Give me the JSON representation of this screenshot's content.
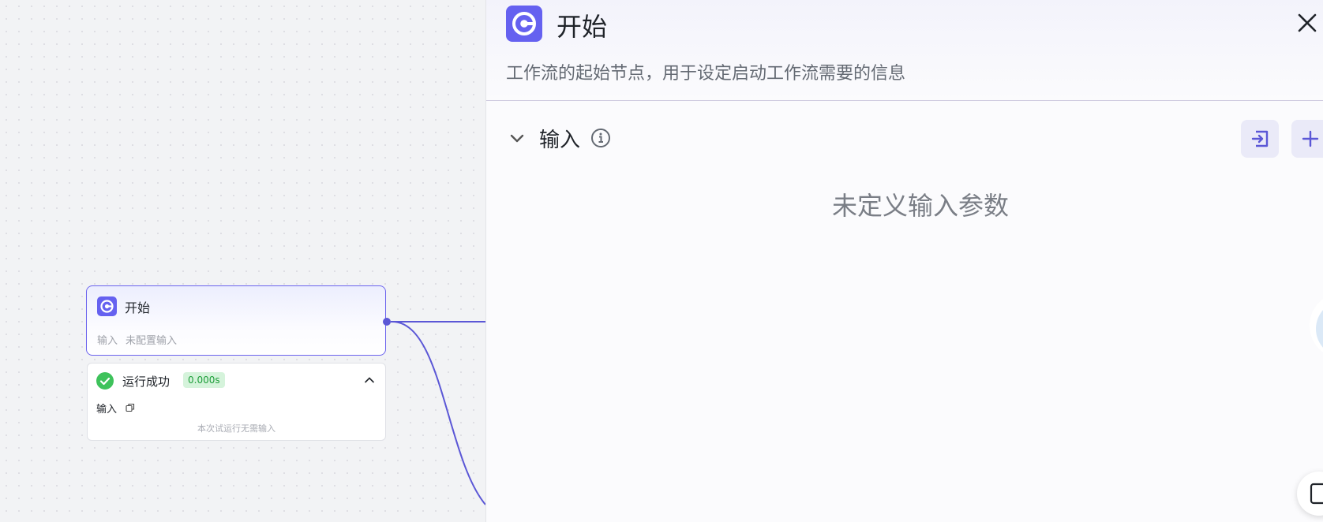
{
  "node": {
    "title": "开始",
    "input_label": "输入",
    "input_value": "未配置输入"
  },
  "run_result": {
    "status": "运行成功",
    "duration": "0.000s",
    "input_label": "输入",
    "empty_message": "本次试运行无需输入"
  },
  "panel": {
    "title": "开始",
    "description": "工作流的起始节点，用于设定启动工作流需要的信息",
    "section_title": "输入",
    "empty_text": "未定义输入参数"
  },
  "colors": {
    "accent": "#6561f0",
    "edge": "#5b57d6",
    "success": "#3ec25b"
  }
}
